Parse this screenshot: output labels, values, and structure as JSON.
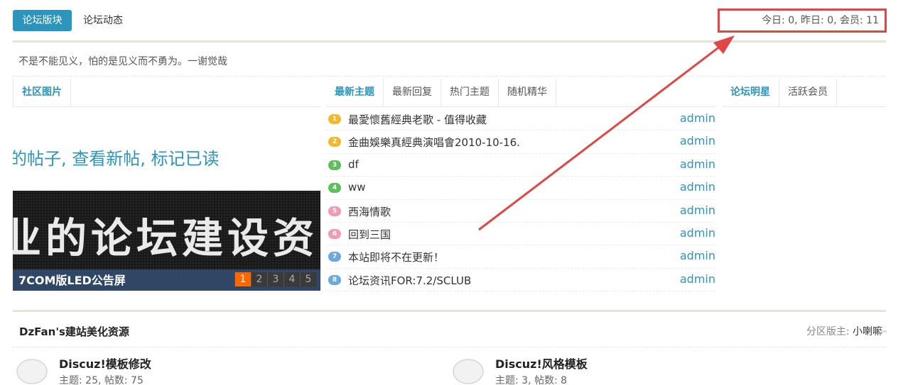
{
  "nav": {
    "tabs": [
      {
        "label": "论坛版块"
      },
      {
        "label": "论坛动态"
      }
    ],
    "stats": "今日: 0, 昨日: 0, 会员: 11"
  },
  "motto": "不是不能见义，怕的是见义而不勇为。一谢觉哉",
  "left_panel": {
    "tab": "社区图片",
    "links": [
      "的帖子",
      "查看新帖",
      "标记已读"
    ],
    "banner_text": "业的论坛建设资",
    "banner_caption": "7COM版LED公告屏",
    "pages": [
      "1",
      "2",
      "3",
      "4",
      "5"
    ]
  },
  "middle_panel": {
    "tabs": [
      "最新主题",
      "最新回复",
      "热门主题",
      "随机精华"
    ],
    "threads": [
      {
        "num": "1",
        "title": "最愛懷舊經典老歌 - 值得收藏",
        "author": "admin",
        "color": "#f5b82a"
      },
      {
        "num": "2",
        "title": "金曲娛樂真經典演唱會2010-10-16.",
        "author": "admin",
        "color": "#f5b82a"
      },
      {
        "num": "3",
        "title": "df",
        "author": "admin",
        "color": "#5cbf5c"
      },
      {
        "num": "4",
        "title": "ww",
        "author": "admin",
        "color": "#5cbf5c"
      },
      {
        "num": "5",
        "title": "西海情歌",
        "author": "admin",
        "color": "#f09ab8"
      },
      {
        "num": "6",
        "title": "回到三国",
        "author": "admin",
        "color": "#f09ab8"
      },
      {
        "num": "7",
        "title": "本站即将不在更新！",
        "author": "admin",
        "color": "#6aa8e0"
      },
      {
        "num": "8",
        "title": "论坛资讯FOR:7.2/SCLUB",
        "author": "admin",
        "color": "#6aa8e0"
      }
    ]
  },
  "right_panel": {
    "tabs": [
      "论坛明星",
      "活跃会员"
    ]
  },
  "section": {
    "title": "DzFan's建站美化资源",
    "moderator_label": "分区版主:",
    "moderator_name": "小喇嘛",
    "forums": [
      {
        "name": "Discuz!模板修改",
        "stats": "主题: 25, 帖数: 75"
      },
      {
        "name": "Discuz!风格模板",
        "stats": "主题: 3, 帖数: 8"
      }
    ]
  },
  "colors": {
    "accent": "#2b95bd",
    "highlight_border": "#e14646",
    "pager_active": "#ff6600"
  }
}
